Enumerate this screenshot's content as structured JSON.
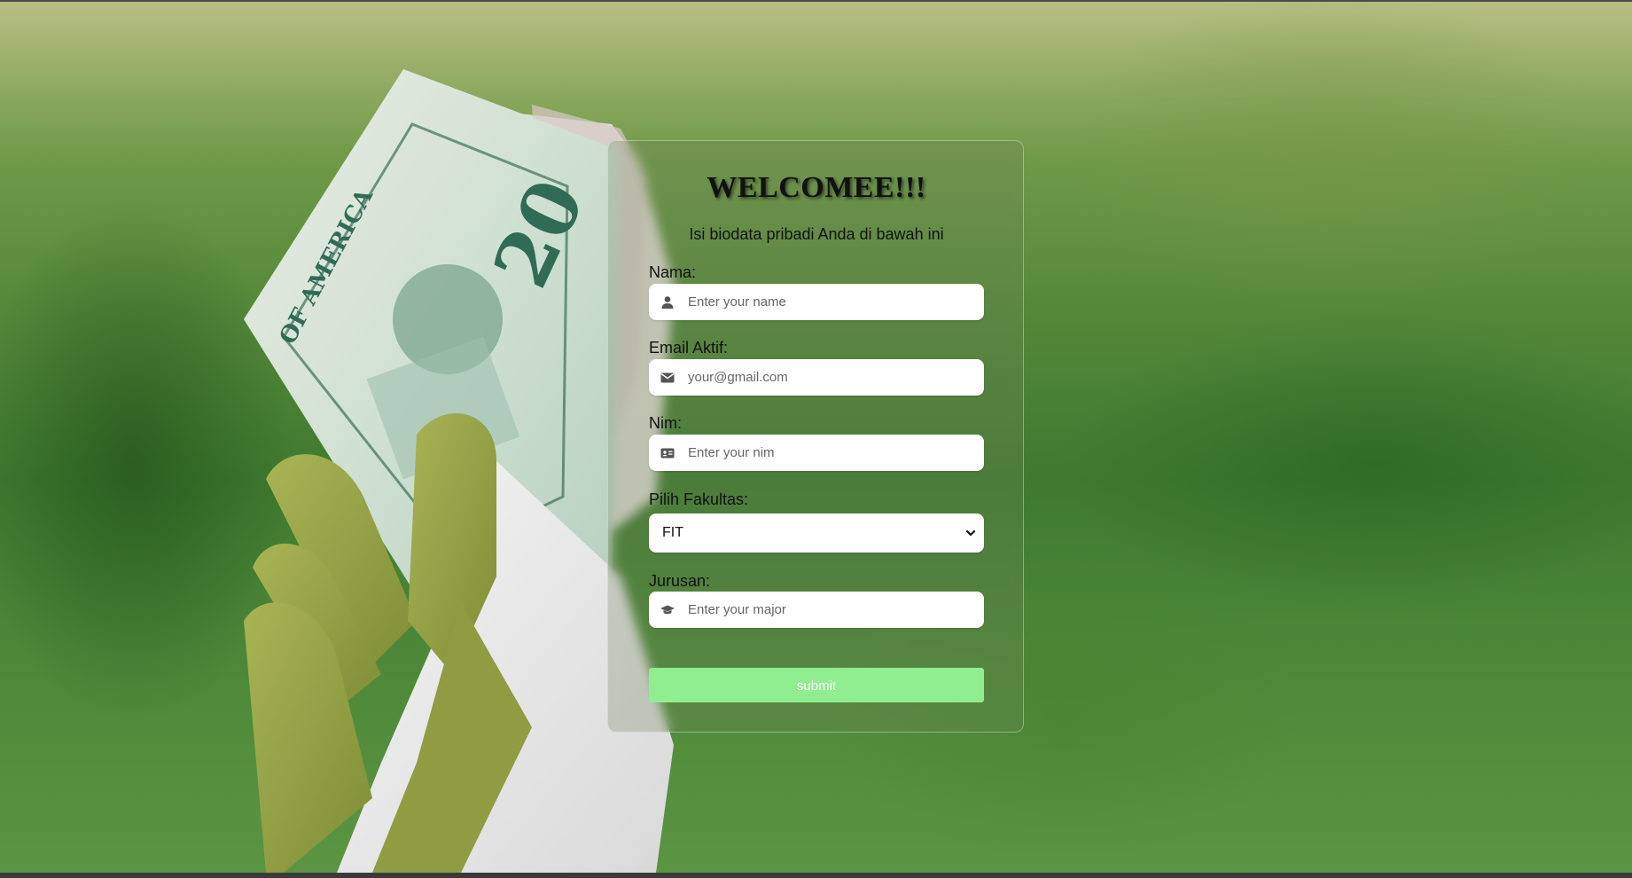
{
  "form": {
    "title": "WELCOMEE!!!",
    "subtitle": "Isi biodata pribadi Anda di bawah ini",
    "fields": {
      "nama": {
        "label": "Nama:",
        "placeholder": "Enter your name",
        "icon": "user-icon"
      },
      "email": {
        "label": "Email Aktif:",
        "placeholder": "your@gmail.com",
        "icon": "envelope-icon"
      },
      "nim": {
        "label": "Nim:",
        "placeholder": "Enter your nim",
        "icon": "id-card-icon"
      },
      "fakultas": {
        "label": "Pilih Fakultas:",
        "selected": "FIT",
        "icon": "chevron-down-icon"
      },
      "jurusan": {
        "label": "Jurusan:",
        "placeholder": "Enter your major",
        "icon": "graduation-cap-icon"
      }
    },
    "submit_label": "submit"
  },
  "colors": {
    "submit_bg": "#90ee90",
    "submit_text": "#ffffff",
    "background_green": "#4c8838"
  }
}
